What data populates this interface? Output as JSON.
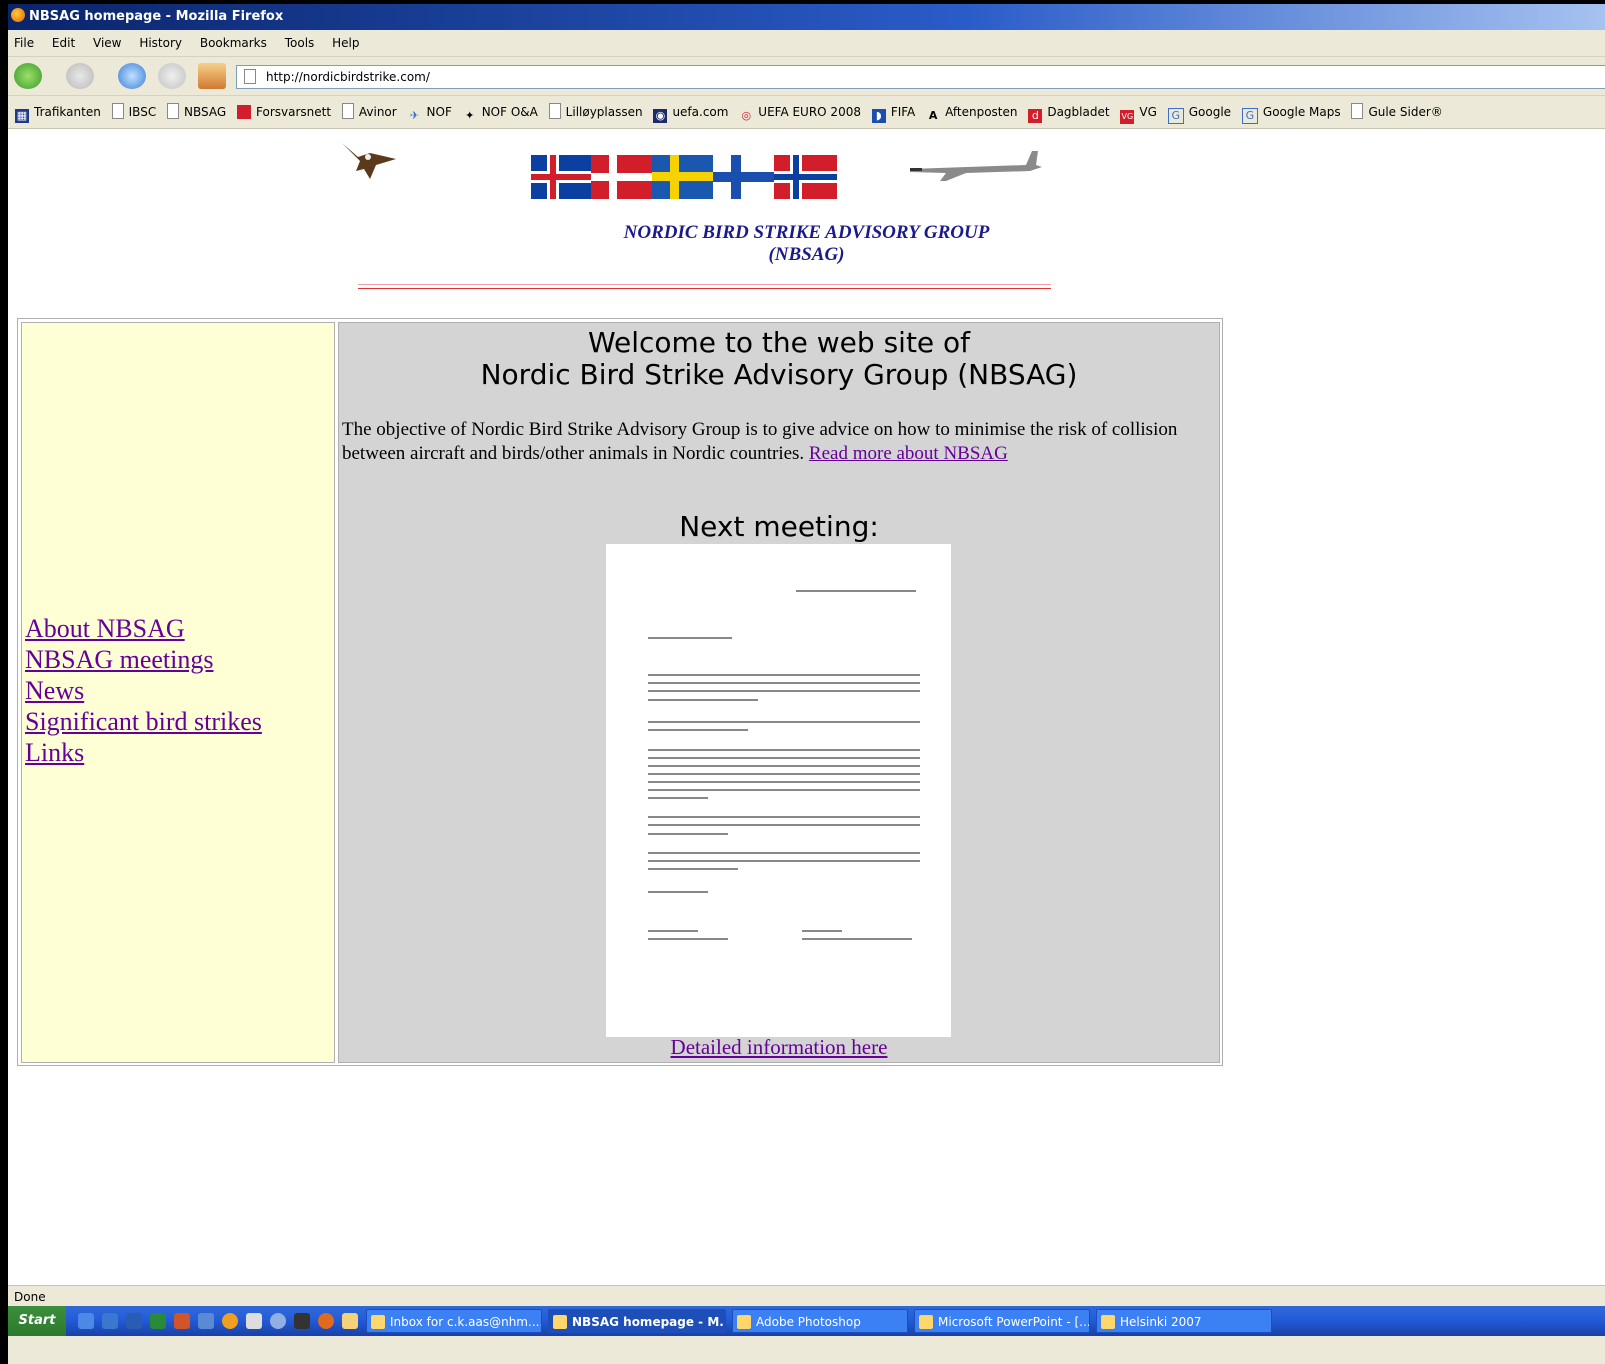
{
  "window": {
    "title": "NBSAG homepage - Mozilla Firefox"
  },
  "menu": [
    "File",
    "Edit",
    "View",
    "History",
    "Bookmarks",
    "Tools",
    "Help"
  ],
  "address": {
    "url": "http://nordicbirdstrike.com/"
  },
  "bookmarks": [
    "Trafikanten",
    "IBSC",
    "NBSAG",
    "Forsvarsnett",
    "Avinor",
    "NOF",
    "NOF O&A",
    "Lilløyplassen",
    "uefa.com",
    "UEFA EURO 2008",
    "FIFA",
    "Aftenposten",
    "Dagbladet",
    "VG",
    "Google",
    "Google Maps",
    "Gule Sider®"
  ],
  "page": {
    "title_line1": "NORDIC BIRD STRIKE ADVISORY GROUP",
    "title_line2": "(NBSAG)",
    "nav": [
      "About NBSAG",
      "NBSAG meetings",
      "News",
      "Significant bird strikes",
      "Links"
    ],
    "welcome_line1": "Welcome to the web site of",
    "welcome_line2": "Nordic Bird Strike Advisory Group (NBSAG)",
    "objective": "The objective of Nordic Bird Strike Advisory Group is to give advice on how to minimise the risk of collision between aircraft and birds/other animals in Nordic countries.",
    "read_more": "Read more about NBSAG",
    "next_meeting": "Next meeting:",
    "detail_link": "Detailed information here"
  },
  "status": {
    "text": "Done"
  },
  "taskbar": {
    "start": "Start",
    "tasks": [
      "Inbox for c.k.aas@nhm....",
      "NBSAG homepage - M...",
      "Adobe Photoshop",
      "Microsoft PowerPoint - [...",
      "Helsinki 2007"
    ]
  }
}
